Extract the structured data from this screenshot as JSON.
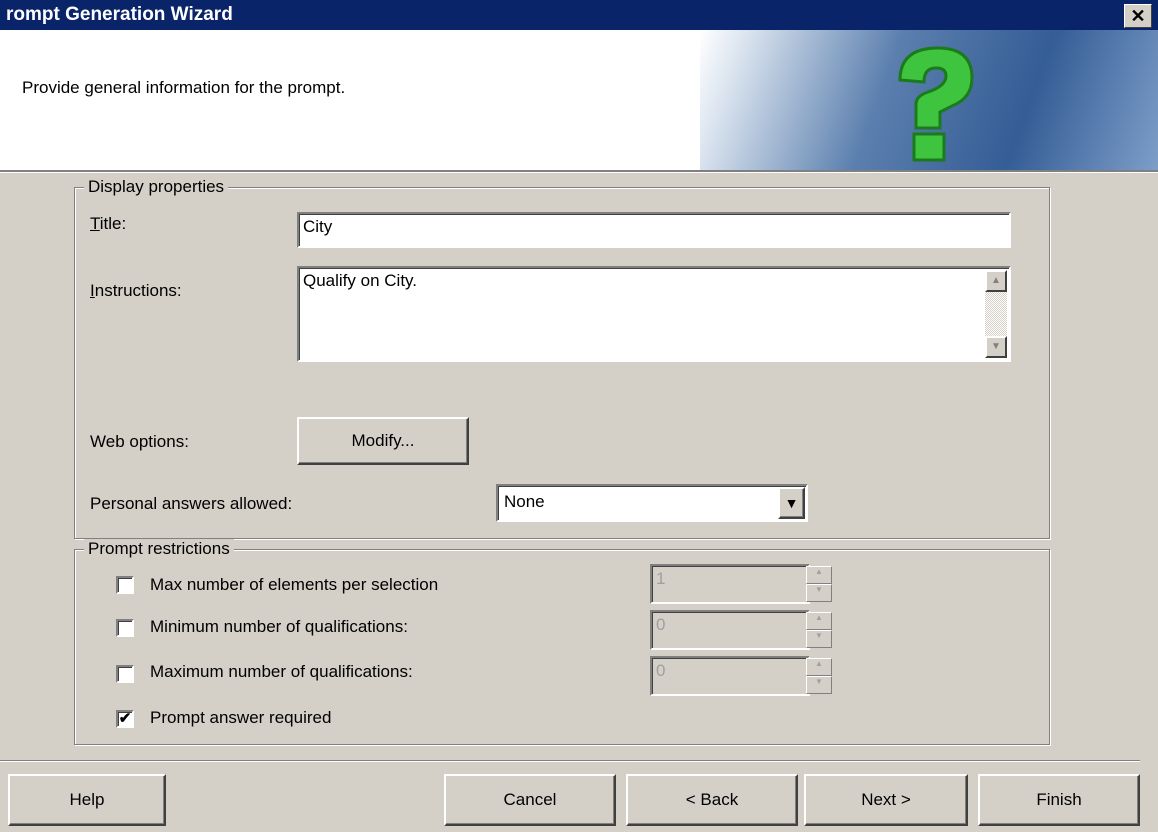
{
  "window": {
    "title": "rompt Generation Wizard",
    "close_glyph": "✕"
  },
  "header": {
    "text": "Provide general information for the prompt.",
    "icon": "question-mark-icon"
  },
  "display_properties": {
    "group_title": "Display properties",
    "title_label_ul": "T",
    "title_label_rest": "itle:",
    "title_value": "City",
    "instructions_label_ul": "I",
    "instructions_label_rest": "nstructions:",
    "instructions_value": "Qualify on City.",
    "web_options_label": "Web options:",
    "modify_button": "Modify...",
    "personal_answers_label": "Personal answers allowed:",
    "personal_answers_value": "None"
  },
  "prompt_restrictions": {
    "group_title": "Prompt restrictions",
    "items": [
      {
        "label": "Max number of elements per selection",
        "checked": false,
        "value": "1"
      },
      {
        "label": "Minimum number of qualifications:",
        "checked": false,
        "value": "0"
      },
      {
        "label": "Maximum number of qualifications:",
        "checked": false,
        "value": "0"
      }
    ],
    "required_label": "Prompt answer required",
    "required_checked": true,
    "check_glyph": "✔"
  },
  "buttons": {
    "help": "Help",
    "cancel": "Cancel",
    "back": "< Back",
    "next": "Next >",
    "finish": "Finish"
  }
}
